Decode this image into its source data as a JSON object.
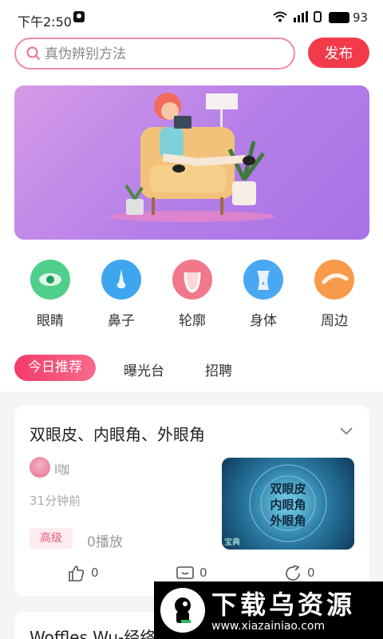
{
  "status_bar": {
    "time": "下午2:50",
    "battery": "93"
  },
  "search": {
    "placeholder": "真伪辨别方法"
  },
  "header": {
    "publish_label": "发布"
  },
  "banner": {
    "caption": ""
  },
  "categories": [
    {
      "label": "眼睛",
      "icon": "eye-icon",
      "color": "#4fcf8a"
    },
    {
      "label": "鼻子",
      "icon": "nose-icon",
      "color": "#3ea6ee"
    },
    {
      "label": "轮廓",
      "icon": "face-contour-icon",
      "color": "#f0788a"
    },
    {
      "label": "身体",
      "icon": "body-icon",
      "color": "#4aa8f2"
    },
    {
      "label": "周边",
      "icon": "eyebrow-icon",
      "color": "#f79a4a"
    }
  ],
  "tabs": {
    "active": "今日推荐",
    "items": [
      "曝光台",
      "招聘"
    ]
  },
  "post": {
    "title": "双眼皮、内眼角、外眼角",
    "author": "l咖",
    "time_ago": "31分钟前",
    "level": "高级",
    "plays": "0播放",
    "thumbnail_lines": [
      "双眼皮",
      "内眼角",
      "外眼角"
    ],
    "thumbnail_watermark": "宝典",
    "likes": "0",
    "comments": "0",
    "shares": "0"
  },
  "post2": {
    "title": "Woffles Wu-经络按摩、眼部按摩"
  },
  "watermark": {
    "title": "下载乌资源",
    "url": "www.xiazainiao.com"
  }
}
